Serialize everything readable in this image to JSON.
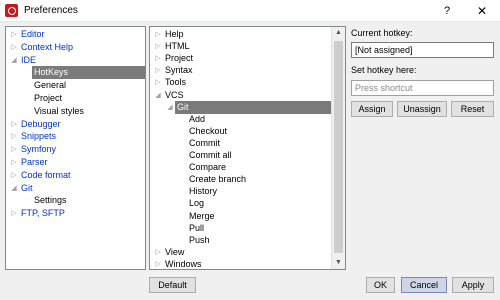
{
  "window": {
    "title": "Preferences",
    "help_glyph": "?",
    "close_glyph": "✕"
  },
  "left_tree": [
    {
      "label": "Editor",
      "expander": true,
      "indent": 0,
      "color": "blue"
    },
    {
      "label": "Context Help",
      "expander": true,
      "indent": 0,
      "color": "blue"
    },
    {
      "label": "IDE",
      "expander": true,
      "indent": 0,
      "color": "blue",
      "expanded": true
    },
    {
      "label": "HotKeys",
      "expander": false,
      "indent": 1,
      "color": "black",
      "selected": true
    },
    {
      "label": "General",
      "expander": false,
      "indent": 1,
      "color": "black"
    },
    {
      "label": "Project",
      "expander": false,
      "indent": 1,
      "color": "black"
    },
    {
      "label": "Visual styles",
      "expander": false,
      "indent": 1,
      "color": "black"
    },
    {
      "label": "Debugger",
      "expander": true,
      "indent": 0,
      "color": "blue"
    },
    {
      "label": "Snippets",
      "expander": true,
      "indent": 0,
      "color": "blue"
    },
    {
      "label": "Symfony",
      "expander": true,
      "indent": 0,
      "color": "blue"
    },
    {
      "label": "Parser",
      "expander": true,
      "indent": 0,
      "color": "blue"
    },
    {
      "label": "Code format",
      "expander": true,
      "indent": 0,
      "color": "blue"
    },
    {
      "label": "Git",
      "expander": true,
      "indent": 0,
      "color": "blue",
      "expanded": true
    },
    {
      "label": "Settings",
      "expander": false,
      "indent": 1,
      "color": "black"
    },
    {
      "label": "FTP, SFTP",
      "expander": true,
      "indent": 0,
      "color": "blue"
    }
  ],
  "mid_tree": [
    {
      "label": "Help",
      "expander": true,
      "indent": 0
    },
    {
      "label": "HTML",
      "expander": true,
      "indent": 0
    },
    {
      "label": "Project",
      "expander": true,
      "indent": 0
    },
    {
      "label": "Syntax",
      "expander": true,
      "indent": 0
    },
    {
      "label": "Tools",
      "expander": true,
      "indent": 0
    },
    {
      "label": "VCS",
      "expander": true,
      "indent": 0,
      "expanded": true
    },
    {
      "label": "Git",
      "expander": true,
      "indent": 1,
      "expanded": true,
      "selected": true
    },
    {
      "label": "Add",
      "expander": false,
      "indent": 2
    },
    {
      "label": "Checkout",
      "expander": false,
      "indent": 2
    },
    {
      "label": "Commit",
      "expander": false,
      "indent": 2
    },
    {
      "label": "Commit all",
      "expander": false,
      "indent": 2
    },
    {
      "label": "Compare",
      "expander": false,
      "indent": 2
    },
    {
      "label": "Create branch",
      "expander": false,
      "indent": 2
    },
    {
      "label": "History",
      "expander": false,
      "indent": 2
    },
    {
      "label": "Log",
      "expander": false,
      "indent": 2
    },
    {
      "label": "Merge",
      "expander": false,
      "indent": 2
    },
    {
      "label": "Pull",
      "expander": false,
      "indent": 2
    },
    {
      "label": "Push",
      "expander": false,
      "indent": 2
    },
    {
      "label": "View",
      "expander": true,
      "indent": 0
    },
    {
      "label": "Windows",
      "expander": true,
      "indent": 0
    }
  ],
  "scroll": {
    "up": "▲",
    "down": "▼"
  },
  "hotkey": {
    "current_label": "Current hotkey:",
    "current_value": "[Not assigned]",
    "set_label": "Set hotkey here:",
    "set_placeholder": "Press shortcut",
    "assign": "Assign",
    "unassign": "Unassign",
    "reset": "Reset"
  },
  "footer": {
    "default": "Default",
    "ok": "OK",
    "cancel": "Cancel",
    "apply": "Apply"
  },
  "colors": {
    "tree_link": "#0033cc",
    "selection": "#7a7a7a",
    "default_button_border": "#0078d7"
  }
}
